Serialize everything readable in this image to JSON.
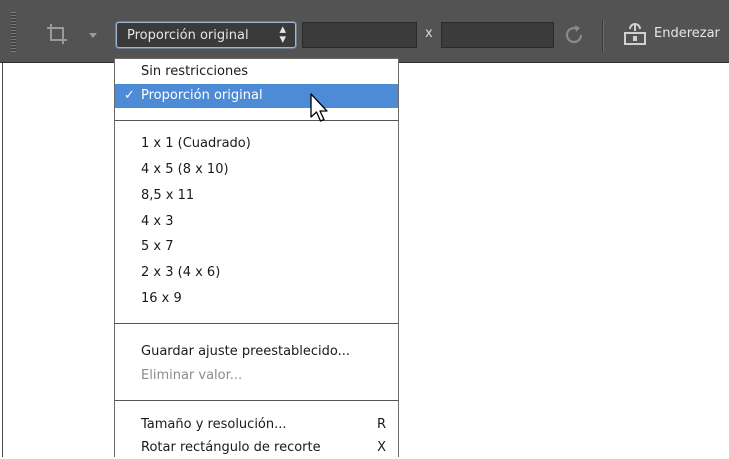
{
  "toolbar": {
    "preset_select": {
      "value": "Proporción original",
      "arrows": "⇕"
    },
    "width_field": {
      "value": ""
    },
    "height_field": {
      "value": ""
    },
    "separator_x": "x",
    "straighten_label": "Enderezar"
  },
  "icons": {
    "crop": "crop-icon",
    "tool_dropdown": "chevron-down-icon",
    "swap": "rotate-icon",
    "straighten": "level-icon",
    "cursor": "mouse-pointer-icon"
  },
  "menu": {
    "group1": [
      {
        "label": "Sin restricciones"
      },
      {
        "label": "Proporción original",
        "checked": true,
        "check_mark": "✓"
      }
    ],
    "group2": [
      {
        "label": "1 x 1 (Cuadrado)"
      },
      {
        "label": "4 x 5 (8 x 10)"
      },
      {
        "label": "8,5 x 11"
      },
      {
        "label": "4 x 3"
      },
      {
        "label": "5 x 7"
      },
      {
        "label": "2 x 3 (4 x 6)"
      },
      {
        "label": "16 x 9"
      }
    ],
    "group3": [
      {
        "label": "Guardar ajuste preestablecido..."
      },
      {
        "label": "Eliminar valor...",
        "disabled": true
      }
    ],
    "group4": [
      {
        "label": "Tamaño y resolución...",
        "shortcut": "R"
      },
      {
        "label": "Rotar rectángulo de recorte",
        "shortcut": "X"
      }
    ]
  },
  "colors": {
    "toolbar_bg": "#535353",
    "selection_bg": "#4d8bd6",
    "disabled_text": "#8c8c8c"
  }
}
